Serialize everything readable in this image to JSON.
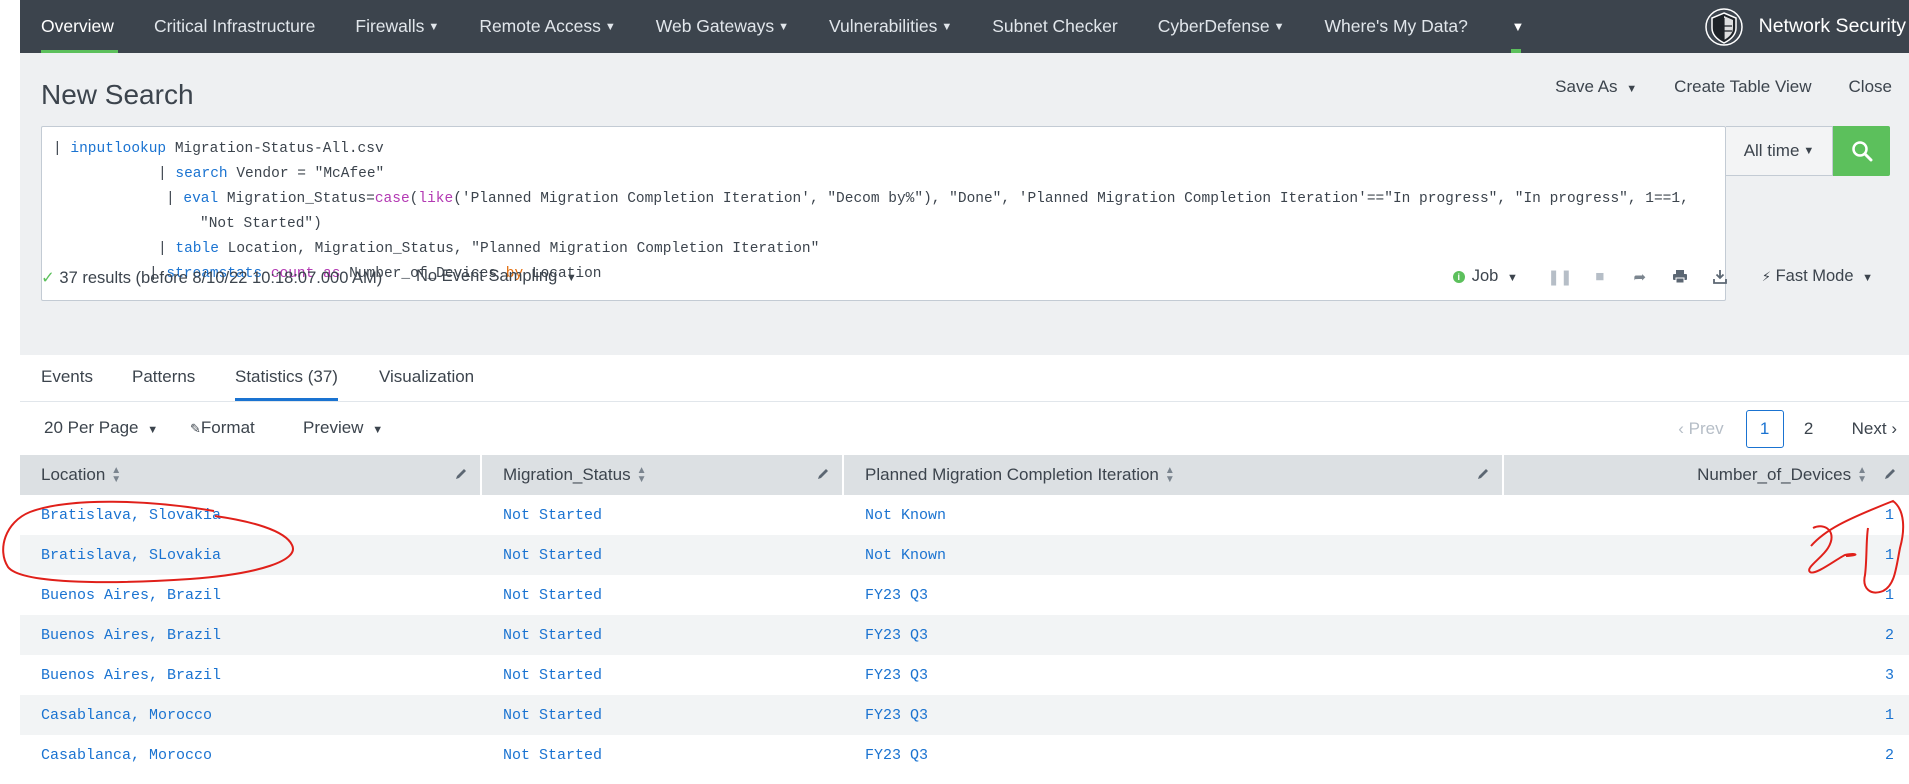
{
  "nav": {
    "items": [
      {
        "label": "Overview",
        "caret": false
      },
      {
        "label": "Critical Infrastructure",
        "caret": false
      },
      {
        "label": "Firewalls",
        "caret": true
      },
      {
        "label": "Remote Access",
        "caret": true
      },
      {
        "label": "Web Gateways",
        "caret": true
      },
      {
        "label": "Vulnerabilities",
        "caret": true
      },
      {
        "label": "Subnet Checker",
        "caret": false
      },
      {
        "label": "CyberDefense",
        "caret": true
      },
      {
        "label": "Where's My Data?",
        "caret": false
      }
    ],
    "app_name": "Network Security"
  },
  "header": {
    "title": "New Search",
    "save_as": "Save As",
    "create_table_view": "Create Table View",
    "close": "Close"
  },
  "search": {
    "lines": [
      [
        [
          "pipe",
          "| "
        ],
        [
          "kw",
          "inputlookup"
        ],
        [
          "txt",
          " Migration-Status-All.csv"
        ]
      ],
      [
        [
          "pipe",
          "| "
        ],
        [
          "kw",
          "search"
        ],
        [
          "txt",
          " Vendor = \"McAfee\""
        ]
      ],
      [
        [
          "pipe",
          "| "
        ],
        [
          "kw",
          "eval"
        ],
        [
          "txt",
          " Migration_Status="
        ],
        [
          "fn",
          "case"
        ],
        [
          "txt",
          "("
        ],
        [
          "fn",
          "like"
        ],
        [
          "txt",
          "('Planned Migration Completion Iteration', \"Decom by%\"), \"Done\", 'Planned Migration Completion Iteration'==\"In progress\", \"In progress\", 1==1,"
        ]
      ],
      [
        [
          "txt",
          "\"Not Started\")"
        ]
      ],
      [
        [
          "pipe",
          "| "
        ],
        [
          "kw",
          "table"
        ],
        [
          "txt",
          " Location, Migration_Status, \"Planned Migration Completion Iteration\""
        ]
      ],
      [
        [
          "pipe",
          "| "
        ],
        [
          "kw",
          "streamstats"
        ],
        [
          "txt",
          " "
        ],
        [
          "fn",
          "count"
        ],
        [
          "txt",
          " "
        ],
        [
          "fn",
          "as"
        ],
        [
          "txt",
          " Number_of_Devices "
        ],
        [
          "op",
          "by"
        ],
        [
          "txt",
          " Location"
        ]
      ]
    ],
    "time_range": "All time"
  },
  "status": {
    "results": "37 results (before 8/10/22 10:18:07.000 AM)",
    "sampling": "No Event Sampling",
    "job": "Job",
    "mode": "Fast Mode"
  },
  "tabs": [
    {
      "label": "Events",
      "active": false
    },
    {
      "label": "Patterns",
      "active": false
    },
    {
      "label": "Statistics (37)",
      "active": true
    },
    {
      "label": "Visualization",
      "active": false
    }
  ],
  "toolbar": {
    "per_page": "20 Per Page",
    "format": "Format",
    "preview": "Preview",
    "prev": "Prev",
    "pages": [
      "1",
      "2"
    ],
    "current_page": "1",
    "next": "Next"
  },
  "table": {
    "columns": [
      "Location",
      "Migration_Status",
      "Planned Migration Completion Iteration",
      "Number_of_Devices"
    ],
    "rows": [
      [
        "Bratislava, Slovakia",
        "Not Started",
        "Not Known",
        "1"
      ],
      [
        "Bratislava, SLovakia",
        "Not Started",
        "Not Known",
        "1"
      ],
      [
        "Buenos Aires, Brazil",
        "Not Started",
        "FY23 Q3",
        "1"
      ],
      [
        "Buenos Aires, Brazil",
        "Not Started",
        "FY23 Q3",
        "2"
      ],
      [
        "Buenos Aires, Brazil",
        "Not Started",
        "FY23 Q3",
        "3"
      ],
      [
        "Casablanca, Morocco",
        "Not Started",
        "FY23 Q3",
        "1"
      ],
      [
        "Casablanca, Morocco",
        "Not Started",
        "FY23 Q3",
        "2"
      ]
    ]
  },
  "colors": {
    "nav_bg": "#3c444d",
    "accent_green": "#5cc05c",
    "link_blue": "#1a73d1",
    "annotation_red": "#e0201a"
  }
}
